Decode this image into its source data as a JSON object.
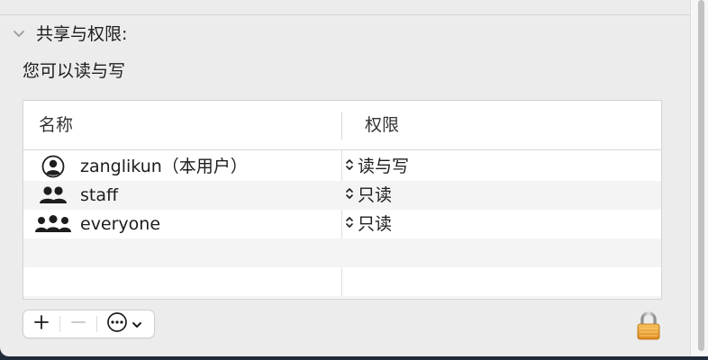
{
  "section": {
    "title": "共享与权限:",
    "summary": "您可以读与写"
  },
  "table": {
    "columns": [
      "名称",
      "权限"
    ],
    "rows": [
      {
        "name": "zanglikun（本用户）",
        "permission": "读与写",
        "icon": "user-single-icon"
      },
      {
        "name": "staff",
        "permission": "只读",
        "icon": "user-group-icon"
      },
      {
        "name": "everyone",
        "permission": "只读",
        "icon": "everyone-icon"
      }
    ]
  },
  "toolbar": {
    "add_icon": "plus-icon",
    "remove_icon": "minus-icon",
    "action_icon": "ellipsis-circle-icon"
  },
  "lock_icon": "lock-icon"
}
